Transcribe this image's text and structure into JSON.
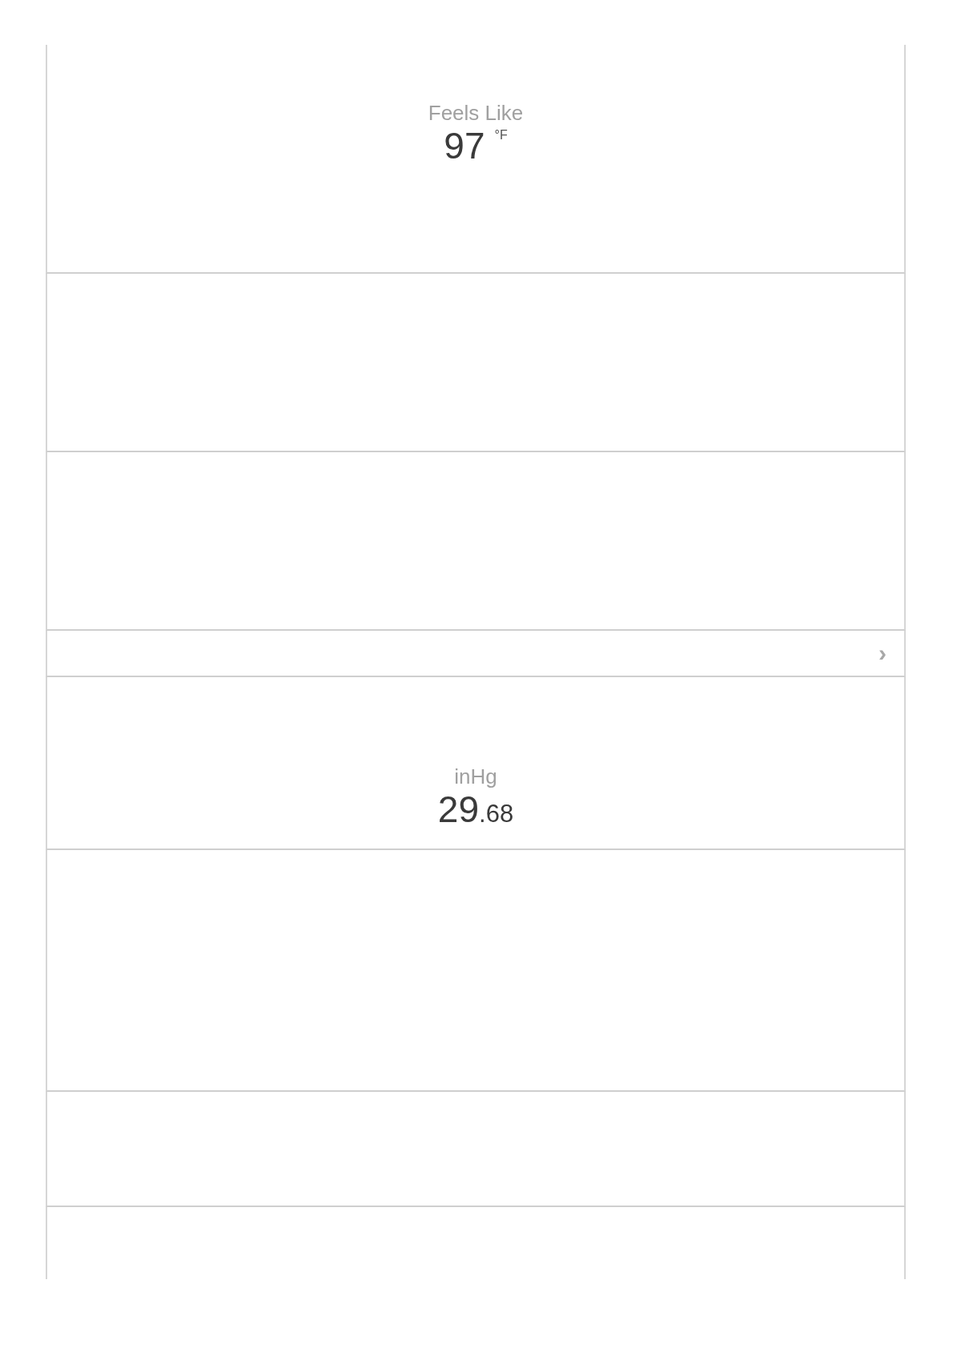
{
  "panels": [
    {
      "kind": "feels_like",
      "label": "Feels Like",
      "value": "97",
      "unit": "°F"
    },
    {
      "kind": "blank"
    },
    {
      "kind": "blank"
    },
    {
      "kind": "link",
      "icon": "›"
    },
    {
      "kind": "pressure",
      "label": "inHg",
      "whole": "29",
      "fraction": ".68"
    },
    {
      "kind": "blank"
    },
    {
      "kind": "blank"
    },
    {
      "kind": "blank"
    }
  ]
}
